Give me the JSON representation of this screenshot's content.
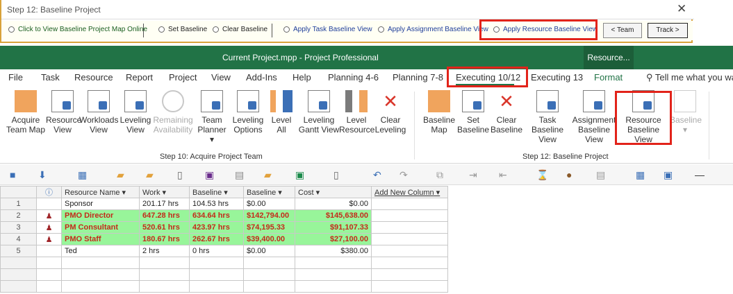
{
  "wizard": {
    "title": "Step 12: Baseline Project",
    "close": "✕",
    "options": [
      {
        "label": "Click to View Baseline Project Map Online",
        "color": "#1a5e20"
      },
      {
        "label": "Set Baseline"
      },
      {
        "label": "Clear Baseline"
      },
      {
        "label": "Apply Task Baseline View",
        "color": "#1f3e9a"
      },
      {
        "label": "Apply Assignment Baseline View",
        "color": "#1f3e9a"
      },
      {
        "label": "Apply Resource Baseline View",
        "color": "#1f3e9a"
      }
    ],
    "back_label": "< Team",
    "next_label": "Track >"
  },
  "app": {
    "title": "Current Project.mpp  -  Project Professional",
    "contextual_tab": "Resource..."
  },
  "tabs": [
    "File",
    "Task",
    "Resource",
    "Report",
    "Project",
    "View",
    "Add-Ins",
    "Help",
    "Planning 4-6",
    "Planning 7-8",
    "Executing 10/12",
    "Executing 13",
    "Format"
  ],
  "active_tab": "Executing 10/12",
  "tell_me": "Tell me what you wa",
  "ribbon": {
    "group1_label": "Step 10: Acquire Project Team",
    "group2_label": "Step 12: Baseline Project",
    "buttons": [
      {
        "line1": "Acquire",
        "line2": "Team Map",
        "icon": "orange-square-icon"
      },
      {
        "line1": "Resource",
        "line2": "View",
        "icon": "resource-view-icon"
      },
      {
        "line1": "Workloads",
        "line2": "View",
        "icon": "workloads-view-icon"
      },
      {
        "line1": "Leveling",
        "line2": "View",
        "icon": "leveling-view-icon"
      },
      {
        "line1": "Remaining",
        "line2": "Availability",
        "icon": "pie-chart-icon",
        "disabled": true
      },
      {
        "line1": "Team",
        "line2": "Planner ▾",
        "icon": "team-planner-icon"
      },
      {
        "line1": "Leveling",
        "line2": "Options",
        "icon": "leveling-options-icon"
      },
      {
        "line1": "Level",
        "line2": "All",
        "icon": "level-all-icon"
      },
      {
        "line1": "Leveling",
        "line2": "Gantt View",
        "icon": "leveling-gantt-icon"
      },
      {
        "line1": "Level",
        "line2": "Resource",
        "icon": "level-resource-icon"
      },
      {
        "line1": "Clear",
        "line2": "Leveling",
        "icon": "clear-leveling-icon"
      },
      {
        "line1": "Baseline",
        "line2": "Map",
        "icon": "orange-square-icon"
      },
      {
        "line1": "Set",
        "line2": "Baseline",
        "icon": "set-baseline-icon"
      },
      {
        "line1": "Clear",
        "line2": "Baseline",
        "icon": "clear-baseline-icon"
      },
      {
        "line1": "Task Baseline",
        "line2": "View",
        "icon": "task-baseline-view-icon"
      },
      {
        "line1": "Assignment",
        "line2": "Baseline View",
        "icon": "assignment-baseline-view-icon"
      },
      {
        "line1": "Resource",
        "line2": "Baseline View",
        "icon": "resource-baseline-view-icon"
      },
      {
        "line1": "Baseline",
        "line2": "▾",
        "icon": "baseline-dropdown-icon",
        "disabled": true
      }
    ]
  },
  "table": {
    "columns": [
      "Resource Name",
      "Work",
      "Baseline",
      "Baseline",
      "Cost",
      "Add New Column"
    ],
    "rows": [
      {
        "id": "1",
        "name": "Sponsor",
        "work": "201.17 hrs",
        "baseline_work": "104.53 hrs",
        "baseline_cost": "$0.00",
        "cost": "$0.00",
        "highlight": false
      },
      {
        "id": "2",
        "name": "PMO Director",
        "work": "647.28 hrs",
        "baseline_work": "634.64 hrs",
        "baseline_cost": "$142,794.00",
        "cost": "$145,638.00",
        "highlight": true
      },
      {
        "id": "3",
        "name": "PM Consultant",
        "work": "520.61 hrs",
        "baseline_work": "423.97 hrs",
        "baseline_cost": "$74,195.33",
        "cost": "$91,107.33",
        "highlight": true
      },
      {
        "id": "4",
        "name": "PMO Staff",
        "work": "180.67 hrs",
        "baseline_work": "262.67 hrs",
        "baseline_cost": "$39,400.00",
        "cost": "$27,100.00",
        "highlight": true
      },
      {
        "id": "5",
        "name": "Ted",
        "work": "2 hrs",
        "baseline_work": "0 hrs",
        "baseline_cost": "$0.00",
        "cost": "$380.00",
        "highlight": false
      }
    ]
  },
  "colors": {
    "app_green": "#217346",
    "highlight_green": "#98f59a",
    "highlight_text": "#c42a1a",
    "callout_red": "#e2231a"
  }
}
